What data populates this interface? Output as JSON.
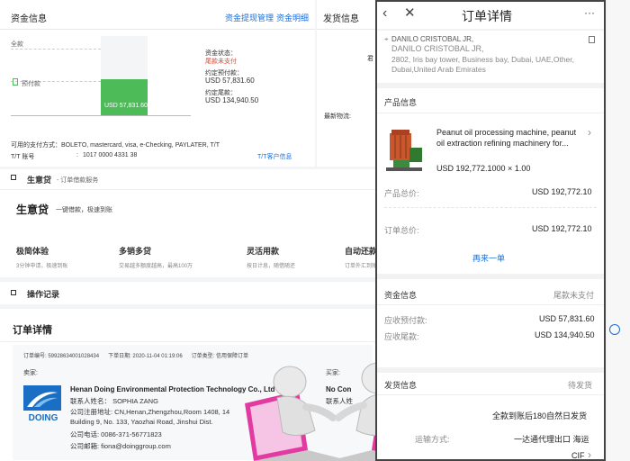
{
  "fund": {
    "title": "资金信息",
    "link_withdraw": "资金提现管理",
    "link_detail": "资金明细",
    "axis_all": "全款",
    "prepay_label": "预付款",
    "bar_amount": "USD 57,831.60",
    "status_label": "资金状态：",
    "status_value": "尾款未支付",
    "agreed_prepay_label": "约定预付款：",
    "agreed_prepay": "USD 57,831.60",
    "agreed_final_label": "约定尾款：",
    "agreed_final": "USD 134,940.50",
    "pay_methods": "可用的支付方式：BOLETO, mastercard, visa, e-Checking, PAYLATER, T/T",
    "tt_label": "T/T 账号",
    "tt_colon": ":",
    "tt_number": "1017 0000 4331 38",
    "tt_link": "T/T客户信息",
    "prepay_fraction": 0.3
  },
  "shipping": {
    "title": "发货信息",
    "latest_label": "最新物流:",
    "partial": "君"
  },
  "loan": {
    "title": "生意贷",
    "subtitle": "- 订单借款服务",
    "headline": "生意贷",
    "tagline": "一键借款，极速到账",
    "features": [
      {
        "title": "极简体验",
        "desc": "3分钟申请，极速到账"
      },
      {
        "title": "多销多贷",
        "desc": "交易越多额度越高，最高100万"
      },
      {
        "title": "灵活用款",
        "desc": "按日计息，随借随还"
      },
      {
        "title": "自动还款",
        "desc": "订单外汇到账自动还款"
      }
    ]
  },
  "ops": {
    "title": "操作记录"
  },
  "order": {
    "title": "订单详情",
    "meta": "订单编号: 59928634001028434      下单日期: 2020-11-04 01:19:06      订单类型: 信用保障订单",
    "seller_label": "卖家:",
    "buyer_label": "买家:",
    "company": "Henan Doing Environmental Protection Technology Co., Ltd",
    "contact": "联系人姓名：  SOPHIA ZANG",
    "address1": "公司注册地址: CN,Henan,Zhengzhou,Room 1408, 14",
    "address2": "Building 9, No. 133, Yaozhai Road, Jinshui Dist.",
    "phone": "公司电话: 0086-371-56771823",
    "email": "公司邮箱: fiona@doinggroup.com",
    "logo_text": "DOING",
    "buyer_name": "No Con",
    "buyer_contact": "联系人姓"
  },
  "phone": {
    "title": "订单详情",
    "back_icon": "chevron-left-icon",
    "close_icon": "close-icon",
    "more": "···",
    "addr_name": "DANILO CRISTOBAL JR,",
    "addr_name2": "DANILO CRISTOBAL JR,",
    "addr_line1": "2802, Iris bay tower, Business bay, Dubai, UAE,Other,",
    "addr_line2": "Dubai,United Arab Emirates",
    "product_section": "产品信息",
    "product_name1": "Peanut oil processing machine, peanut",
    "product_name2": "oil extraction refining machinery for...",
    "product_price": "USD 192,772.1000 × 1.00",
    "product_total_label": "产品总价:",
    "product_total": "USD 192,772.10",
    "order_total_label": "订单总价:",
    "order_total": "USD 192,772.10",
    "reorder": "再来一单",
    "fund_section": "资金信息",
    "fund_status": "尾款未支付",
    "prepay_label": "应收预付款:",
    "prepay": "USD 57,831.60",
    "final_label": "应收尾款:",
    "final": "USD 134,940.50",
    "ship_section": "发货信息",
    "ship_status": "待发货",
    "ship_time": "全款到账后180自然日发货",
    "ship_method_label": "运输方式:",
    "ship_method": "一达通代理出口 海运",
    "trade_term": "CIF"
  }
}
